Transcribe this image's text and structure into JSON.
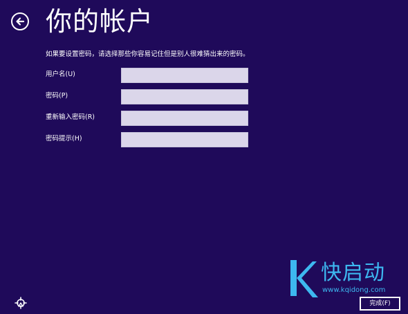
{
  "header": {
    "title": "你的帐户",
    "back_icon": "back-arrow-icon"
  },
  "instruction": "如果要设置密码，请选择那些你容易记住但是别人很难猜出来的密码。",
  "form": {
    "fields": [
      {
        "label": "用户名(U)",
        "value": "",
        "placeholder": ""
      },
      {
        "label": "密码(P)",
        "value": "",
        "placeholder": ""
      },
      {
        "label": "重新输入密码(R)",
        "value": "",
        "placeholder": ""
      },
      {
        "label": "密码提示(H)",
        "value": "",
        "placeholder": ""
      }
    ]
  },
  "footer": {
    "ease_icon": "ease-of-access-icon",
    "finish_label": "完成(F)"
  },
  "watermark": {
    "brand": "快启动",
    "url": "www.kqidong.com"
  },
  "colors": {
    "background": "#1f0a5a",
    "input_fill": "#dbd6ea",
    "text": "#ffffff",
    "watermark": "#3db8f0"
  }
}
